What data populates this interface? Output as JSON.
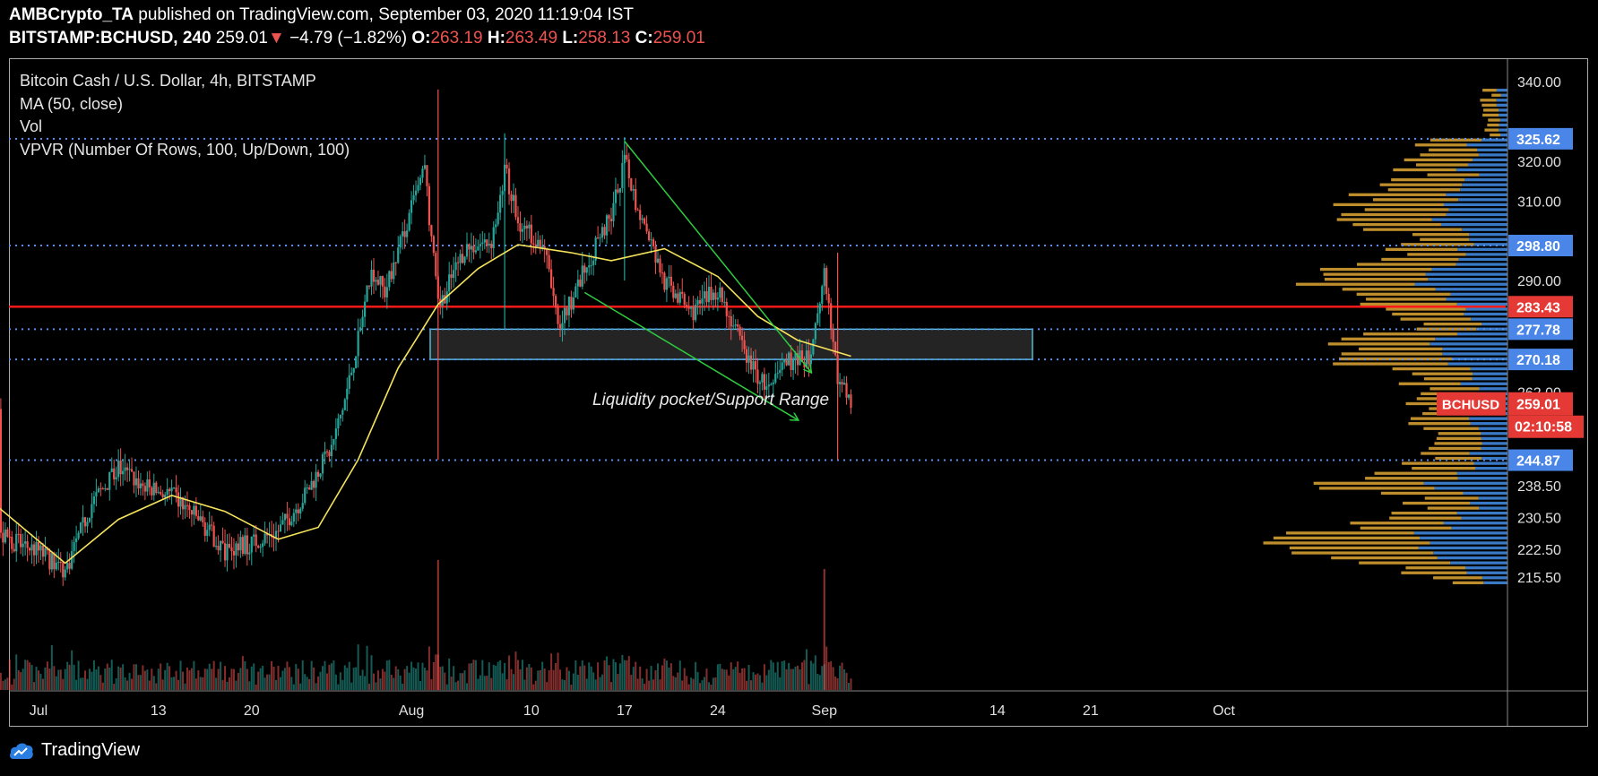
{
  "header": {
    "author": "AMBCrypto_TA",
    "published_text": "published on TradingView.com, September 03, 2020 11:19:04 IST",
    "symbol": "BITSTAMP:BCHUSD, 240",
    "last": "259.01",
    "change_arrow": "▼",
    "change": "−4.79 (−1.82%)",
    "o_label": "O:",
    "o_value": "263.19",
    "h_label": "H:",
    "h_value": "263.49",
    "l_label": "L:",
    "l_value": "258.13",
    "c_label": "C:",
    "c_value": "259.01"
  },
  "legend": {
    "title": "Bitcoin Cash / U.S. Dollar, 4h, BITSTAMP",
    "ma": "MA (50, close)",
    "vol": "Vol",
    "vpvr": "VPVR (Number Of Rows, 100, Up/Down, 100)"
  },
  "annotation": "Liquidity pocket/Support Range",
  "footer": {
    "brand": "TradingView"
  },
  "colors": {
    "up": "#26a69a",
    "down": "#ef5350",
    "ma": "#f5e35b",
    "level_line": "#5b8def",
    "resistance": "#ff1a1a",
    "vpvr_up": "#3d7fd1",
    "vpvr_down": "#c9962e",
    "trend": "#2ecc40",
    "zone_border": "#5fd3f3"
  },
  "chart_data": {
    "type": "candlestick",
    "symbol": "BCHUSD",
    "timeframe": "4h",
    "ylim": [
      211,
      342
    ],
    "y_ticks": [
      340.0,
      320.0,
      310.0,
      290.0,
      262.0,
      238.5,
      230.5,
      222.5,
      215.5
    ],
    "x_ticks": [
      "Jul",
      "13",
      "20",
      "Aug",
      "10",
      "17",
      "24",
      "Sep",
      "14",
      "21",
      "Oct"
    ],
    "last_price": 259.01,
    "countdown": "02:10:58",
    "symbol_tag": "BCHUSD",
    "horizontal_levels": [
      {
        "value": 325.62,
        "style": "dotted",
        "label": "325.62"
      },
      {
        "value": 298.8,
        "style": "dotted",
        "label": "298.80"
      },
      {
        "value": 283.43,
        "style": "solid-red",
        "label": "283.43"
      },
      {
        "value": 277.78,
        "style": "dotted",
        "label": "277.78"
      },
      {
        "value": 270.18,
        "style": "dotted",
        "label": "270.18"
      },
      {
        "value": 244.87,
        "style": "dotted",
        "label": "244.87"
      }
    ],
    "support_zone": {
      "from": 270.18,
      "to": 277.78,
      "label": "Liquidity pocket/Support Range"
    },
    "price_path": [
      {
        "date": "Jul 01",
        "close": 226
      },
      {
        "date": "Jul 04",
        "close": 222
      },
      {
        "date": "Jul 06",
        "close": 217
      },
      {
        "date": "Jul 08",
        "close": 234
      },
      {
        "date": "Jul 10",
        "close": 243
      },
      {
        "date": "Jul 12",
        "close": 238
      },
      {
        "date": "Jul 14",
        "close": 236
      },
      {
        "date": "Jul 16",
        "close": 230
      },
      {
        "date": "Jul 18",
        "close": 222
      },
      {
        "date": "Jul 20",
        "close": 224
      },
      {
        "date": "Jul 22",
        "close": 227
      },
      {
        "date": "Jul 24",
        "close": 236
      },
      {
        "date": "Jul 26",
        "close": 248
      },
      {
        "date": "Jul 27",
        "close": 260
      },
      {
        "date": "Jul 28",
        "close": 275
      },
      {
        "date": "Jul 29",
        "close": 293
      },
      {
        "date": "Jul 30",
        "close": 287
      },
      {
        "date": "Aug 01",
        "close": 308
      },
      {
        "date": "Aug 02",
        "close": 318
      },
      {
        "date": "Aug 03",
        "close": 283
      },
      {
        "date": "Aug 05",
        "close": 298
      },
      {
        "date": "Aug 07",
        "close": 300
      },
      {
        "date": "Aug 08",
        "close": 318
      },
      {
        "date": "Aug 09",
        "close": 305
      },
      {
        "date": "Aug 11",
        "close": 298
      },
      {
        "date": "Aug 12",
        "close": 278
      },
      {
        "date": "Aug 13",
        "close": 285
      },
      {
        "date": "Aug 15",
        "close": 300
      },
      {
        "date": "Aug 16",
        "close": 306
      },
      {
        "date": "Aug 17",
        "close": 320
      },
      {
        "date": "Aug 18",
        "close": 308
      },
      {
        "date": "Aug 20",
        "close": 290
      },
      {
        "date": "Aug 22",
        "close": 282
      },
      {
        "date": "Aug 24",
        "close": 288
      },
      {
        "date": "Aug 26",
        "close": 272
      },
      {
        "date": "Aug 27",
        "close": 266
      },
      {
        "date": "Aug 28",
        "close": 262
      },
      {
        "date": "Aug 29",
        "close": 270
      },
      {
        "date": "Aug 31",
        "close": 270
      },
      {
        "date": "Sep 01",
        "close": 292
      },
      {
        "date": "Sep 02",
        "close": 265
      },
      {
        "date": "Sep 03",
        "close": 259
      }
    ],
    "ma50_path": [
      {
        "date": "Jul 01",
        "value": 233
      },
      {
        "date": "Jul 06",
        "value": 219
      },
      {
        "date": "Jul 10",
        "value": 230
      },
      {
        "date": "Jul 14",
        "value": 236
      },
      {
        "date": "Jul 18",
        "value": 232
      },
      {
        "date": "Jul 22",
        "value": 225
      },
      {
        "date": "Jul 25",
        "value": 228
      },
      {
        "date": "Jul 28",
        "value": 245
      },
      {
        "date": "Jul 31",
        "value": 268
      },
      {
        "date": "Aug 03",
        "value": 284
      },
      {
        "date": "Aug 06",
        "value": 293
      },
      {
        "date": "Aug 09",
        "value": 299
      },
      {
        "date": "Aug 13",
        "value": 297
      },
      {
        "date": "Aug 16",
        "value": 295
      },
      {
        "date": "Aug 20",
        "value": 298
      },
      {
        "date": "Aug 24",
        "value": 291
      },
      {
        "date": "Aug 27",
        "value": 281
      },
      {
        "date": "Aug 30",
        "value": 275
      },
      {
        "date": "Sep 03",
        "value": 271
      }
    ],
    "trendlines": [
      {
        "from": {
          "date": "Aug 17",
          "value": 325
        },
        "to": {
          "date": "Aug 31",
          "value": 267
        }
      },
      {
        "from": {
          "date": "Aug 14",
          "value": 287
        },
        "to": {
          "date": "Aug 30",
          "value": 255
        }
      }
    ]
  }
}
